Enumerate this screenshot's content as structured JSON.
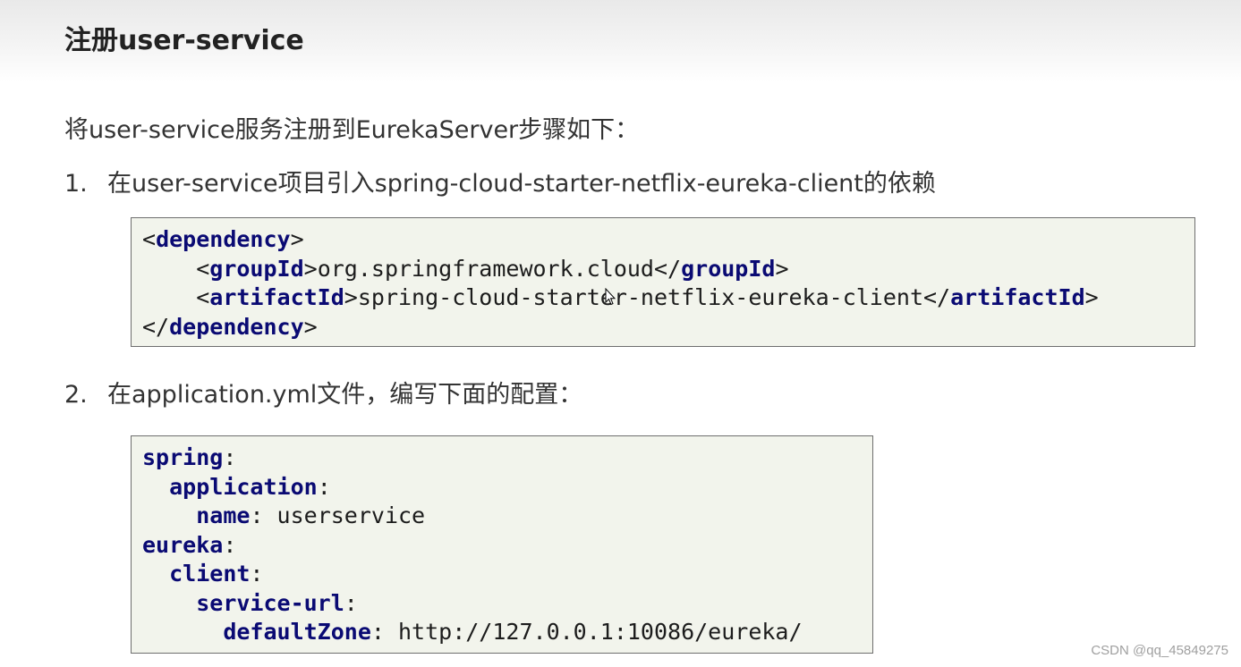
{
  "title": "注册user-service",
  "intro": "将user-service服务注册到EurekaServer步骤如下：",
  "steps": [
    {
      "number": "1.",
      "text": "在user-service项目引入spring-cloud-starter-netflix-eureka-client的依赖"
    },
    {
      "number": "2.",
      "text": "在application.yml文件，编写下面的配置："
    }
  ],
  "code_xml": {
    "dependency_tag": "dependency",
    "groupId_tag": "groupId",
    "groupId_value": "org.springframework.cloud",
    "artifactId_tag": "artifactId",
    "artifactId_value": "spring-cloud-starter-netflix-eureka-client"
  },
  "code_yml": {
    "spring": "spring",
    "application": "application",
    "name_key": "name",
    "name_value": "userservice",
    "eureka": "eureka",
    "client": "client",
    "service_url": "service-url",
    "default_zone_key": "defaultZone",
    "default_zone_value": "http://127.0.0.1:10086/eureka/"
  },
  "watermark": "CSDN @qq_45849275",
  "colors": {
    "keyword": "#0a0a73",
    "code_background": "#f2f4ec",
    "code_border": "#6e6e6e",
    "text": "#333333"
  },
  "icons": [
    "mouse-cursor-icon"
  ]
}
